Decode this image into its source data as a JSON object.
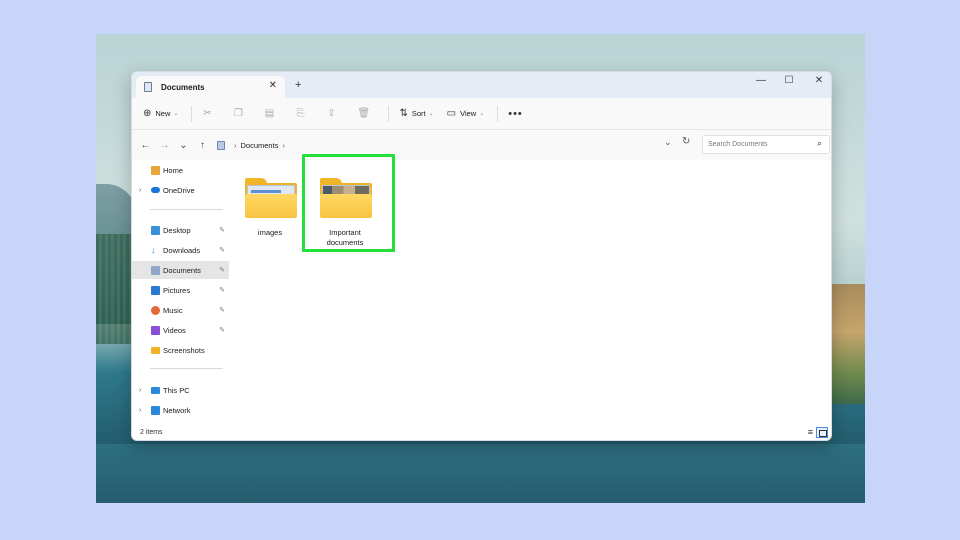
{
  "window": {
    "tab_title": "Documents",
    "new_tab": "+",
    "tab_close": "✕",
    "controls": {
      "minimize": "—",
      "maximize": "☐",
      "close": "✕"
    }
  },
  "toolbar": {
    "new_label": "New",
    "sort_label": "Sort",
    "view_label": "View",
    "more": "•••"
  },
  "address": {
    "crumb": "Documents",
    "search_placeholder": "Search Documents"
  },
  "sidebar": {
    "items": [
      {
        "label": "Home",
        "icon": "home-icon",
        "color": "#e8a53a"
      },
      {
        "label": "OneDrive",
        "icon": "cloud-icon",
        "color": "#1a73d9"
      },
      {
        "label": "Desktop",
        "icon": "desktop-icon",
        "color": "#3a8fd9"
      },
      {
        "label": "Downloads",
        "icon": "download-icon",
        "color": "#2a8ad9"
      },
      {
        "label": "Documents",
        "icon": "documents-icon",
        "color": "#8fa6c9"
      },
      {
        "label": "Pictures",
        "icon": "pictures-icon",
        "color": "#2b79d1"
      },
      {
        "label": "Music",
        "icon": "music-icon",
        "color": "#e06a3a"
      },
      {
        "label": "Videos",
        "icon": "videos-icon",
        "color": "#8a4fd9"
      },
      {
        "label": "Screenshots",
        "icon": "folder-icon",
        "color": "#f0b327"
      },
      {
        "label": "This PC",
        "icon": "pc-icon",
        "color": "#2a8ad9"
      },
      {
        "label": "Network",
        "icon": "network-icon",
        "color": "#2a8ad9"
      }
    ],
    "selected": "Documents"
  },
  "content": {
    "folders": [
      {
        "name": "images"
      },
      {
        "name": "Important documents"
      }
    ]
  },
  "status": {
    "item_count": "2 items"
  },
  "colors": {
    "highlight": "#22e03a",
    "accent": "#4b8be2"
  }
}
